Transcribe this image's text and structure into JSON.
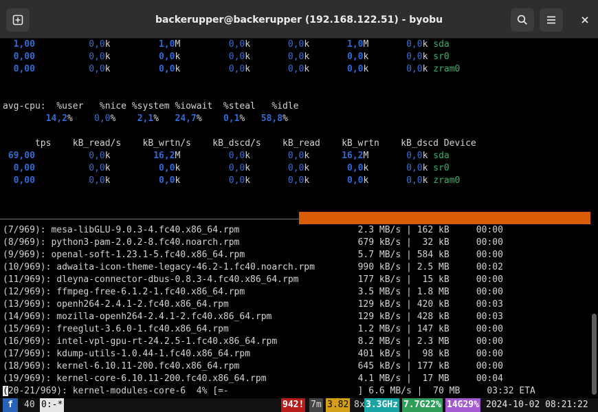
{
  "window": {
    "title": "backerupper@backerupper (192.168.122.51) - byobu"
  },
  "iostat_top": [
    {
      "tps": "1,00",
      "rd": "0,0",
      "wr": "1,0",
      "wru": "M",
      "ds": "0,0",
      "r": "0,0",
      "w": "1,0",
      "wu": "M",
      "d": "0,0",
      "dev": "sda"
    },
    {
      "tps": "0,00",
      "rd": "0,0",
      "wr": "0,0",
      "wru": "k",
      "ds": "0,0",
      "r": "0,0",
      "w": "0,0",
      "wu": "k",
      "d": "0,0",
      "dev": "sr0"
    },
    {
      "tps": "0,00",
      "rd": "0,0",
      "wr": "0,0",
      "wru": "k",
      "ds": "0,0",
      "r": "0,0",
      "w": "0,0",
      "wu": "k",
      "d": "0,0",
      "dev": "zram0"
    }
  ],
  "avgcpu": {
    "header": "avg-cpu:  %user   %nice %system %iowait  %steal   %idle",
    "values": [
      "14,2",
      "0,0",
      "2,1",
      "24,7",
      "0,1",
      "58,8"
    ]
  },
  "dev_header": "      tps    kB_read/s    kB_wrtn/s    kB_dscd/s    kB_read    kB_wrtn    kB_dscd Device",
  "iostat_bottom": [
    {
      "tps": "69,00",
      "rd": "0,0",
      "wr": "16,2",
      "wru": "M",
      "ds": "0,0",
      "r": "0,0",
      "w": "16,2",
      "wu": "M",
      "d": "0,0",
      "dev": "sda"
    },
    {
      "tps": "0,00",
      "rd": "0,0",
      "wr": "0,0",
      "wru": "k",
      "ds": "0,0",
      "r": "0,0",
      "w": "0,0",
      "wu": "k",
      "d": "0,0",
      "dev": "sr0"
    },
    {
      "tps": "0,00",
      "rd": "0,0",
      "wr": "0,0",
      "wru": "k",
      "ds": "0,0",
      "r": "0,0",
      "w": "0,0",
      "wu": "k",
      "d": "0,0",
      "dev": "zram0"
    }
  ],
  "downloads": [
    {
      "idx": "(7/969)",
      "name": "mesa-libGLU-9.0.3-4.fc40.x86_64.rpm",
      "rate": "2.3 MB/s",
      "size": "162 kB",
      "eta": "00:00"
    },
    {
      "idx": "(8/969)",
      "name": "python3-pam-2.0.2-8.fc40.noarch.rpm",
      "rate": "679 kB/s",
      "size": " 32 kB",
      "eta": "00:00"
    },
    {
      "idx": "(9/969)",
      "name": "openal-soft-1.23.1-5.fc40.x86_64.rpm",
      "rate": "5.7 MB/s",
      "size": "584 kB",
      "eta": "00:00"
    },
    {
      "idx": "(10/969)",
      "name": "adwaita-icon-theme-legacy-46.2-1.fc40.noarch.rpm",
      "rate": "990 kB/s",
      "size": "2.5 MB",
      "eta": "00:02"
    },
    {
      "idx": "(11/969)",
      "name": "dleyna-connector-dbus-0.8.3-4.fc40.x86_64.rpm",
      "rate": "177 kB/s",
      "size": " 15 kB",
      "eta": "00:00"
    },
    {
      "idx": "(12/969)",
      "name": "ffmpeg-free-6.1.2-1.fc40.x86_64.rpm",
      "rate": "3.5 MB/s",
      "size": "1.8 MB",
      "eta": "00:00"
    },
    {
      "idx": "(13/969)",
      "name": "openh264-2.4.1-2.fc40.x86_64.rpm",
      "rate": "129 kB/s",
      "size": "420 kB",
      "eta": "00:03"
    },
    {
      "idx": "(14/969)",
      "name": "mozilla-openh264-2.4.1-2.fc40.x86_64.rpm",
      "rate": "129 kB/s",
      "size": "428 kB",
      "eta": "00:03"
    },
    {
      "idx": "(15/969)",
      "name": "freeglut-3.6.0-1.fc40.x86_64.rpm",
      "rate": "1.2 MB/s",
      "size": "147 kB",
      "eta": "00:00"
    },
    {
      "idx": "(16/969)",
      "name": "intel-vpl-gpu-rt-24.2.5-1.fc40.x86_64.rpm",
      "rate": "8.2 MB/s",
      "size": "2.3 MB",
      "eta": "00:00"
    },
    {
      "idx": "(17/969)",
      "name": "kdump-utils-1.0.44-1.fc40.x86_64.rpm",
      "rate": "401 kB/s",
      "size": " 98 kB",
      "eta": "00:00"
    },
    {
      "idx": "(18/969)",
      "name": "kernel-6.10.11-200.fc40.x86_64.rpm",
      "rate": "645 kB/s",
      "size": "177 kB",
      "eta": "00:00"
    },
    {
      "idx": "(19/969)",
      "name": "kernel-core-6.10.11-200.fc40.x86_64.rpm",
      "rate": "4.1 MB/s",
      "size": " 17 MB",
      "eta": "00:04"
    }
  ],
  "current_download": {
    "cursor_char": "(",
    "text": "20-21/969): kernel-modules-core-6  4% [=-                        ] 6.6 MB/s |  70 MB     03:32 ETA"
  },
  "statusbar": {
    "logo": "f",
    "window_num": "40",
    "window_name": "0:-*",
    "updates": "942!",
    "uptime": "7m",
    "load": "3.82",
    "cpu_count": "8x",
    "cpu_freq": "3.3GHz",
    "mem_total": "7.7G",
    "mem_pct": "22%",
    "disk_total": "14G",
    "disk_pct": "29%",
    "datetime": "2024-10-02 08:21:22"
  },
  "colors": {
    "titlebar": "#2e2e2e",
    "progress": "#d85d06",
    "value_blue": "#3c6ec8",
    "device_green": "#36b36a",
    "updates_red": "#b71c1c",
    "load_yellow": "#d4a017",
    "freq_teal": "#1aa3a3",
    "mem_green": "#2e9e5a",
    "disk_purple": "#a35ad0"
  }
}
